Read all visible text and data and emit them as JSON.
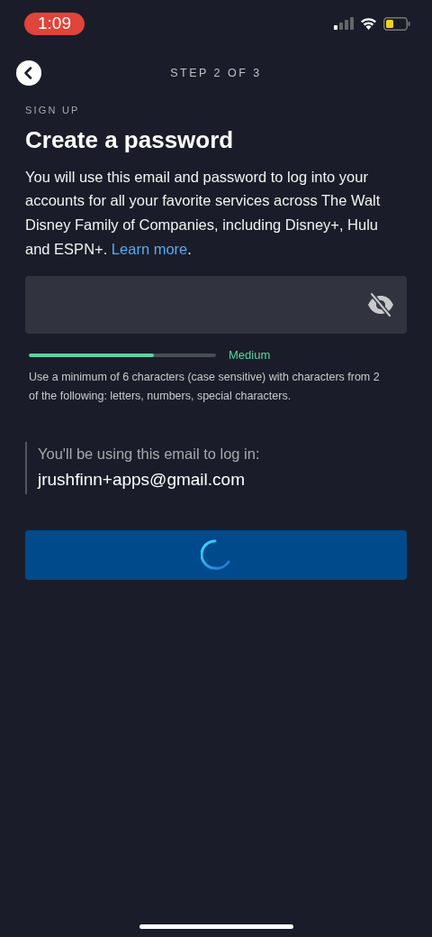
{
  "status_bar": {
    "time": "1:09"
  },
  "header": {
    "step": "STEP 2 OF 3"
  },
  "eyebrow": "SIGN UP",
  "title": "Create a password",
  "intro": {
    "text": "You will use this email and password to log into your accounts for all your favorite services across The Walt Disney Family of Companies, including Disney+, Hulu and ESPN+. ",
    "link": "Learn more",
    "after": "."
  },
  "password_field": {
    "password_hidden": true
  },
  "strength": {
    "level": 0.67,
    "label": "Medium"
  },
  "hint": "Use a minimum of 6 characters (case sensitive) with characters from 2 of the following: letters, numbers, special characters.",
  "email_note": {
    "label": "You'll be using this email to log in:",
    "email": "jrushfinn+apps@gmail.com"
  },
  "continue_button": {
    "loading": true
  }
}
